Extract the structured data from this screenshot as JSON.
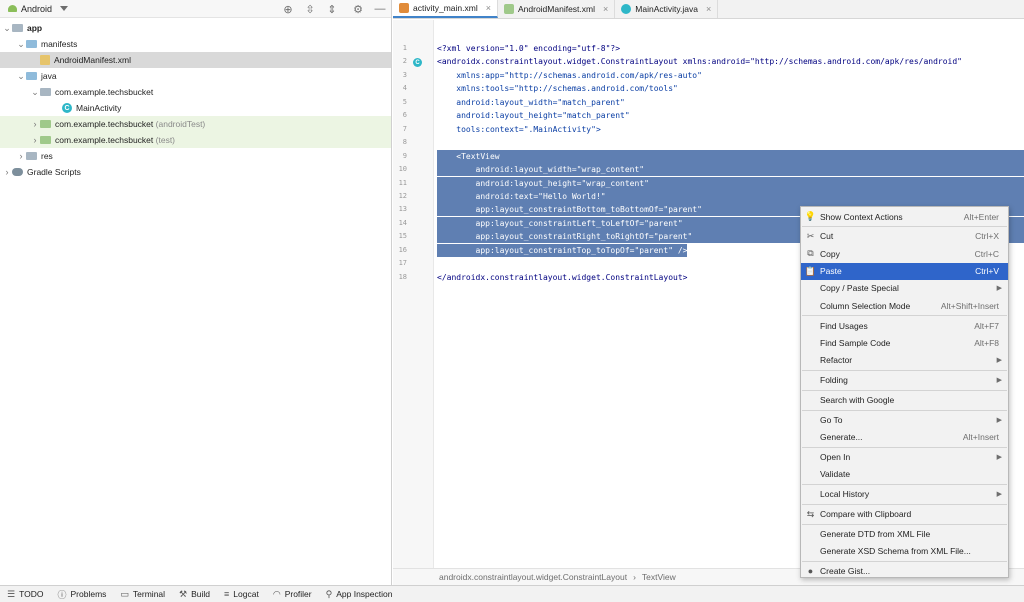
{
  "project_panel": {
    "view_label": "Android",
    "tree": [
      {
        "label": "app",
        "suffix": "",
        "level": 0,
        "expanded": true,
        "kind": "module"
      },
      {
        "label": "manifests",
        "suffix": "",
        "level": 1,
        "expanded": true,
        "kind": "folder"
      },
      {
        "label": "AndroidManifest.xml",
        "suffix": "",
        "level": 2,
        "expanded": null,
        "kind": "xml"
      },
      {
        "label": "java",
        "suffix": "",
        "level": 1,
        "expanded": true,
        "kind": "folder"
      },
      {
        "label": "com.example.techsbucket",
        "suffix": "",
        "level": 2,
        "expanded": true,
        "kind": "package"
      },
      {
        "label": "MainActivity",
        "suffix": "",
        "level": 3,
        "expanded": null,
        "kind": "class"
      },
      {
        "label": "com.example.techsbucket",
        "suffix": "(androidTest)",
        "level": 2,
        "expanded": false,
        "kind": "package-test"
      },
      {
        "label": "com.example.techsbucket",
        "suffix": "(test)",
        "level": 2,
        "expanded": false,
        "kind": "package-test"
      },
      {
        "label": "res",
        "suffix": "",
        "level": 1,
        "expanded": false,
        "kind": "res"
      },
      {
        "label": "Gradle Scripts",
        "suffix": "",
        "level": 0,
        "expanded": false,
        "kind": "gradle"
      }
    ]
  },
  "tabs": [
    {
      "label": "activity_main.xml",
      "active": true,
      "icon": "xml-layout-icon"
    },
    {
      "label": "AndroidManifest.xml",
      "active": false,
      "icon": "manifest-icon"
    },
    {
      "label": "MainActivity.java",
      "active": false,
      "icon": "java-class-icon"
    }
  ],
  "editor": {
    "lines": [
      {
        "n": "1",
        "text": "<?xml version=\"1.0\" encoding=\"utf-8\"?>"
      },
      {
        "n": "2",
        "text": "<androidx.constraintlayout.widget.ConstraintLayout xmlns:android=\"http://schemas.android.com/apk/res/android\""
      },
      {
        "n": "3",
        "text": "    xmlns:app=\"http://schemas.android.com/apk/res-auto\""
      },
      {
        "n": "4",
        "text": "    xmlns:tools=\"http://schemas.android.com/tools\""
      },
      {
        "n": "5",
        "text": "    android:layout_width=\"match_parent\""
      },
      {
        "n": "6",
        "text": "    android:layout_height=\"match_parent\""
      },
      {
        "n": "7",
        "text": "    tools:context=\".MainActivity\">"
      },
      {
        "n": "8",
        "text": ""
      },
      {
        "n": "9",
        "text": "    <TextView"
      },
      {
        "n": "10",
        "text": "        android:layout_width=\"wrap_content\""
      },
      {
        "n": "11",
        "text": "        android:layout_height=\"wrap_content\""
      },
      {
        "n": "12",
        "text": "        android:text=\"Hello World!\""
      },
      {
        "n": "13",
        "text": "        app:layout_constraintBottom_toBottomOf=\"parent\""
      },
      {
        "n": "14",
        "text": "        app:layout_constraintLeft_toLeftOf=\"parent\""
      },
      {
        "n": "15",
        "text": "        app:layout_constraintRight_toRightOf=\"parent\""
      },
      {
        "n": "16",
        "text": "        app:layout_constraintTop_toTopOf=\"parent\" />"
      },
      {
        "n": "17",
        "text": ""
      },
      {
        "n": "18",
        "text": "</androidx.constraintlayout.widget.ConstraintLayout>"
      }
    ],
    "breadcrumb": [
      "androidx.constraintlayout.widget.ConstraintLayout",
      "TextView"
    ]
  },
  "context_menu": {
    "items": [
      {
        "label": "Show Context Actions",
        "shortcut": "Alt+Enter",
        "icon": "bulb-icon",
        "submenu": false,
        "highlighted": false,
        "sep_after": true
      },
      {
        "label": "Cut",
        "shortcut": "Ctrl+X",
        "icon": "scissors-icon",
        "submenu": false,
        "highlighted": false,
        "sep_after": false
      },
      {
        "label": "Copy",
        "shortcut": "Ctrl+C",
        "icon": "copy-icon",
        "submenu": false,
        "highlighted": false,
        "sep_after": false
      },
      {
        "label": "Paste",
        "shortcut": "Ctrl+V",
        "icon": "paste-icon",
        "submenu": false,
        "highlighted": true,
        "sep_after": false
      },
      {
        "label": "Copy / Paste Special",
        "shortcut": "",
        "icon": "",
        "submenu": true,
        "highlighted": false,
        "sep_after": false
      },
      {
        "label": "Column Selection Mode",
        "shortcut": "Alt+Shift+Insert",
        "icon": "",
        "submenu": false,
        "highlighted": false,
        "sep_after": true
      },
      {
        "label": "Find Usages",
        "shortcut": "Alt+F7",
        "icon": "",
        "submenu": false,
        "highlighted": false,
        "sep_after": false
      },
      {
        "label": "Find Sample Code",
        "shortcut": "Alt+F8",
        "icon": "",
        "submenu": false,
        "highlighted": false,
        "sep_after": false
      },
      {
        "label": "Refactor",
        "shortcut": "",
        "icon": "",
        "submenu": true,
        "highlighted": false,
        "sep_after": true
      },
      {
        "label": "Folding",
        "shortcut": "",
        "icon": "",
        "submenu": true,
        "highlighted": false,
        "sep_after": true
      },
      {
        "label": "Search with Google",
        "shortcut": "",
        "icon": "",
        "submenu": false,
        "highlighted": false,
        "sep_after": true
      },
      {
        "label": "Go To",
        "shortcut": "",
        "icon": "",
        "submenu": true,
        "highlighted": false,
        "sep_after": false
      },
      {
        "label": "Generate...",
        "shortcut": "Alt+Insert",
        "icon": "",
        "submenu": false,
        "highlighted": false,
        "sep_after": true
      },
      {
        "label": "Open In",
        "shortcut": "",
        "icon": "",
        "submenu": true,
        "highlighted": false,
        "sep_after": false
      },
      {
        "label": "Validate",
        "shortcut": "",
        "icon": "",
        "submenu": false,
        "highlighted": false,
        "sep_after": true
      },
      {
        "label": "Local History",
        "shortcut": "",
        "icon": "",
        "submenu": true,
        "highlighted": false,
        "sep_after": true
      },
      {
        "label": "Compare with Clipboard",
        "shortcut": "",
        "icon": "compare-icon",
        "submenu": false,
        "highlighted": false,
        "sep_after": true
      },
      {
        "label": "Generate DTD from XML File",
        "shortcut": "",
        "icon": "",
        "submenu": false,
        "highlighted": false,
        "sep_after": false
      },
      {
        "label": "Generate XSD Schema from XML File...",
        "shortcut": "",
        "icon": "",
        "submenu": false,
        "highlighted": false,
        "sep_after": true
      },
      {
        "label": "Create Gist...",
        "shortcut": "",
        "icon": "github-icon",
        "submenu": false,
        "highlighted": false,
        "sep_after": false
      }
    ]
  },
  "bottom_bar": [
    {
      "label": "TODO",
      "icon": "list-icon"
    },
    {
      "label": "Problems",
      "icon": "info-icon"
    },
    {
      "label": "Terminal",
      "icon": "terminal-icon"
    },
    {
      "label": "Build",
      "icon": "hammer-icon"
    },
    {
      "label": "Logcat",
      "icon": "logcat-icon"
    },
    {
      "label": "Profiler",
      "icon": "gauge-icon"
    },
    {
      "label": "App Inspection",
      "icon": "inspect-icon"
    }
  ],
  "colors": {
    "selection": "#5f7fb2",
    "menu_highlight": "#2f65ca",
    "tree_selected": "#d9d9d9",
    "tree_test": "#ecf5e3",
    "xml_tag": "#000080",
    "xml_value": "#067d17"
  }
}
